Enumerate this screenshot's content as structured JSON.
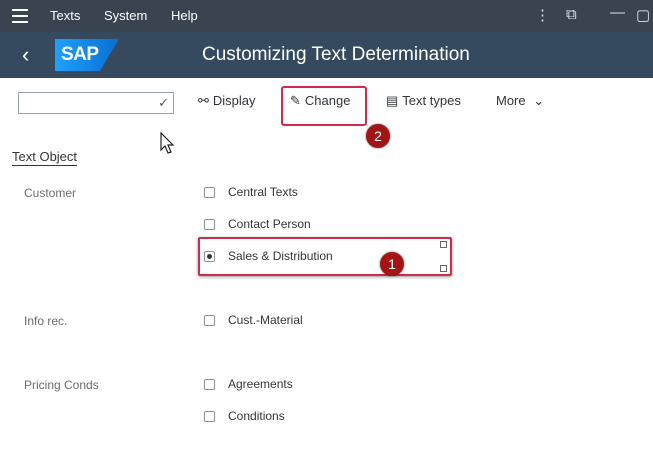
{
  "menubar": {
    "items": [
      "Texts",
      "System",
      "Help"
    ],
    "icons": [
      "hamburger-icon",
      "more-vertical-icon",
      "new-window-icon",
      "minimize-icon",
      "maximize-icon"
    ]
  },
  "header": {
    "logo": "SAP",
    "title": "Customizing Text Determination"
  },
  "toolbar": {
    "command_field_value": "",
    "buttons": [
      {
        "label": "Display",
        "icon": "glasses-icon"
      },
      {
        "label": "Change",
        "icon": "pencil-icon"
      },
      {
        "label": "Text types",
        "icon": "document-icon"
      },
      {
        "label": "More",
        "icon": "chevron-down-icon"
      }
    ]
  },
  "annotations": {
    "badge_1": "1",
    "badge_2": "2"
  },
  "text_object": {
    "title": "Text Object",
    "groups": [
      {
        "label": "Customer",
        "options": [
          {
            "label": "Central Texts",
            "selected": false
          },
          {
            "label": "Contact Person",
            "selected": false
          },
          {
            "label": "Sales & Distribution",
            "selected": true
          }
        ]
      },
      {
        "label": "Info rec.",
        "options": [
          {
            "label": "Cust.-Material",
            "selected": false
          }
        ]
      },
      {
        "label": "Pricing Conds",
        "options": [
          {
            "label": "Agreements",
            "selected": false
          },
          {
            "label": "Conditions",
            "selected": false
          }
        ]
      }
    ]
  },
  "colors": {
    "menubar_bg": "#3a4450",
    "header_bg": "#354a5f",
    "highlight": "#cf2b4b",
    "badge": "#a31515"
  }
}
